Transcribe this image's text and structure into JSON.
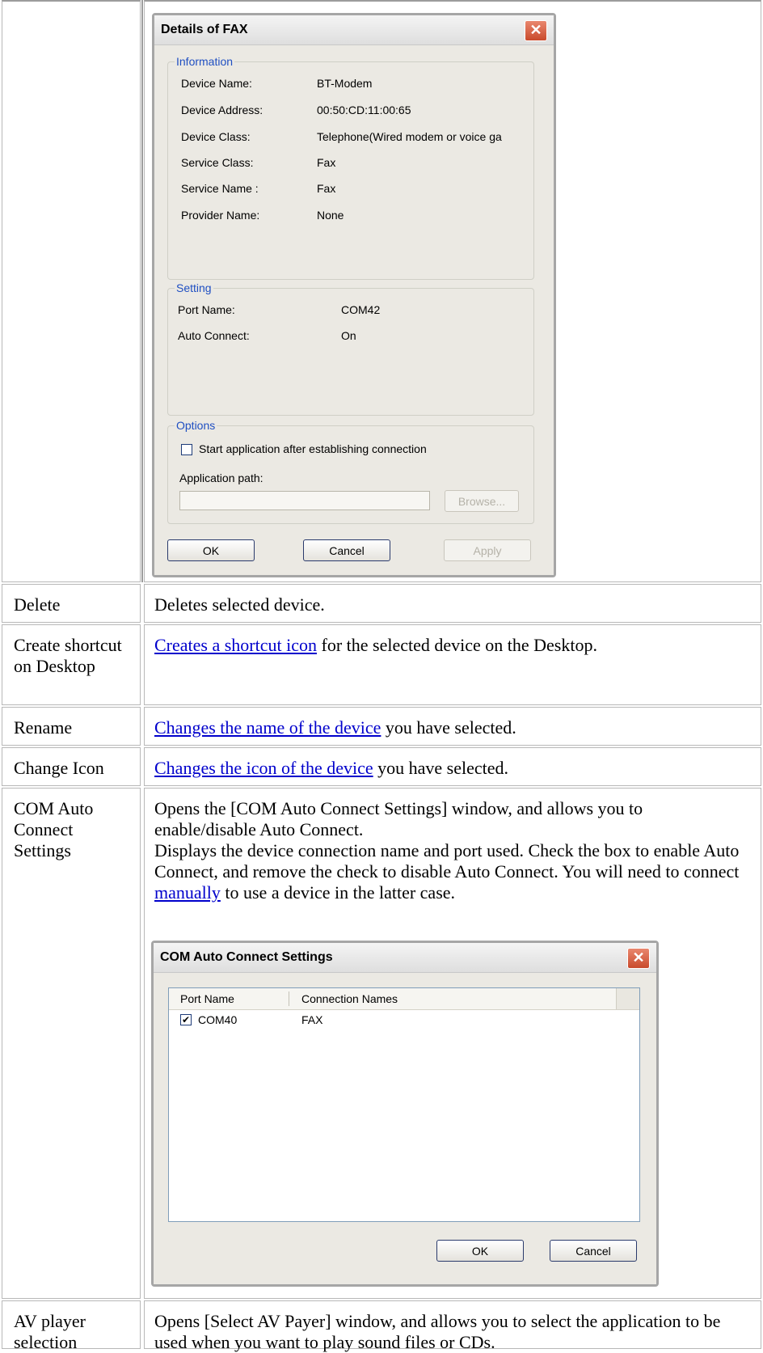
{
  "fax_dialog": {
    "title": "Details of FAX",
    "close_glyph": "✕",
    "info_group": "Information",
    "info_rows": [
      {
        "label": "Device Name:",
        "value": "BT-Modem"
      },
      {
        "label": "Device Address:",
        "value": "00:50:CD:11:00:65"
      },
      {
        "label": "Device Class:",
        "value": "Telephone(Wired modem or voice ga"
      },
      {
        "label": "Service Class:",
        "value": "Fax"
      },
      {
        "label": "Service Name :",
        "value": "Fax"
      },
      {
        "label": "Provider Name:",
        "value": "None"
      }
    ],
    "setting_group": "Setting",
    "setting_rows": [
      {
        "label": "Port Name:",
        "value": "COM42"
      },
      {
        "label": "Auto Connect:",
        "value": "On"
      }
    ],
    "options_group": "Options",
    "start_app_checkbox": "Start application after establishing connection",
    "start_app_checked": false,
    "app_path_label": "Application path:",
    "app_path_value": "",
    "browse_button": "Browse...",
    "ok_button": "OK",
    "cancel_button": "Cancel",
    "apply_button": "Apply"
  },
  "rows": {
    "delete": {
      "label": "Delete",
      "desc": "Deletes selected device."
    },
    "shortcut": {
      "label": "Create shortcut on Desktop",
      "link": "Creates a shortcut icon",
      "rest": " for the selected device on the Desktop."
    },
    "rename": {
      "label": "Rename",
      "link": "Changes the name of the device",
      "rest": " you have selected."
    },
    "change_icon": {
      "label": "Change Icon",
      "link": "Changes the icon of the device",
      "rest": " you have selected."
    },
    "com_auto": {
      "label": "COM Auto Connect Settings",
      "p1": "Opens the [COM Auto Connect Settings] window, and allows you to enable/disable Auto Connect.",
      "p2_a": "Displays the device connection name and port used. Check the box to enable Auto Connect, and remove the check to disable Auto Connect. You will need to connect ",
      "p2_link": "manually",
      "p2_b": " to use a device in the latter case."
    },
    "av_player": {
      "label": "AV player selection",
      "desc": "Opens [Select AV Payer] window, and allows you to select the application to be used when you want to play sound files or CDs."
    }
  },
  "com_dialog": {
    "title": "COM Auto Connect Settings",
    "close_glyph": "✕",
    "col_port": "Port Name",
    "col_conn": "Connection Names",
    "rows": [
      {
        "port": "COM40",
        "conn": "FAX",
        "checked": true
      }
    ],
    "check_glyph": "✔",
    "ok_button": "OK",
    "cancel_button": "Cancel"
  }
}
